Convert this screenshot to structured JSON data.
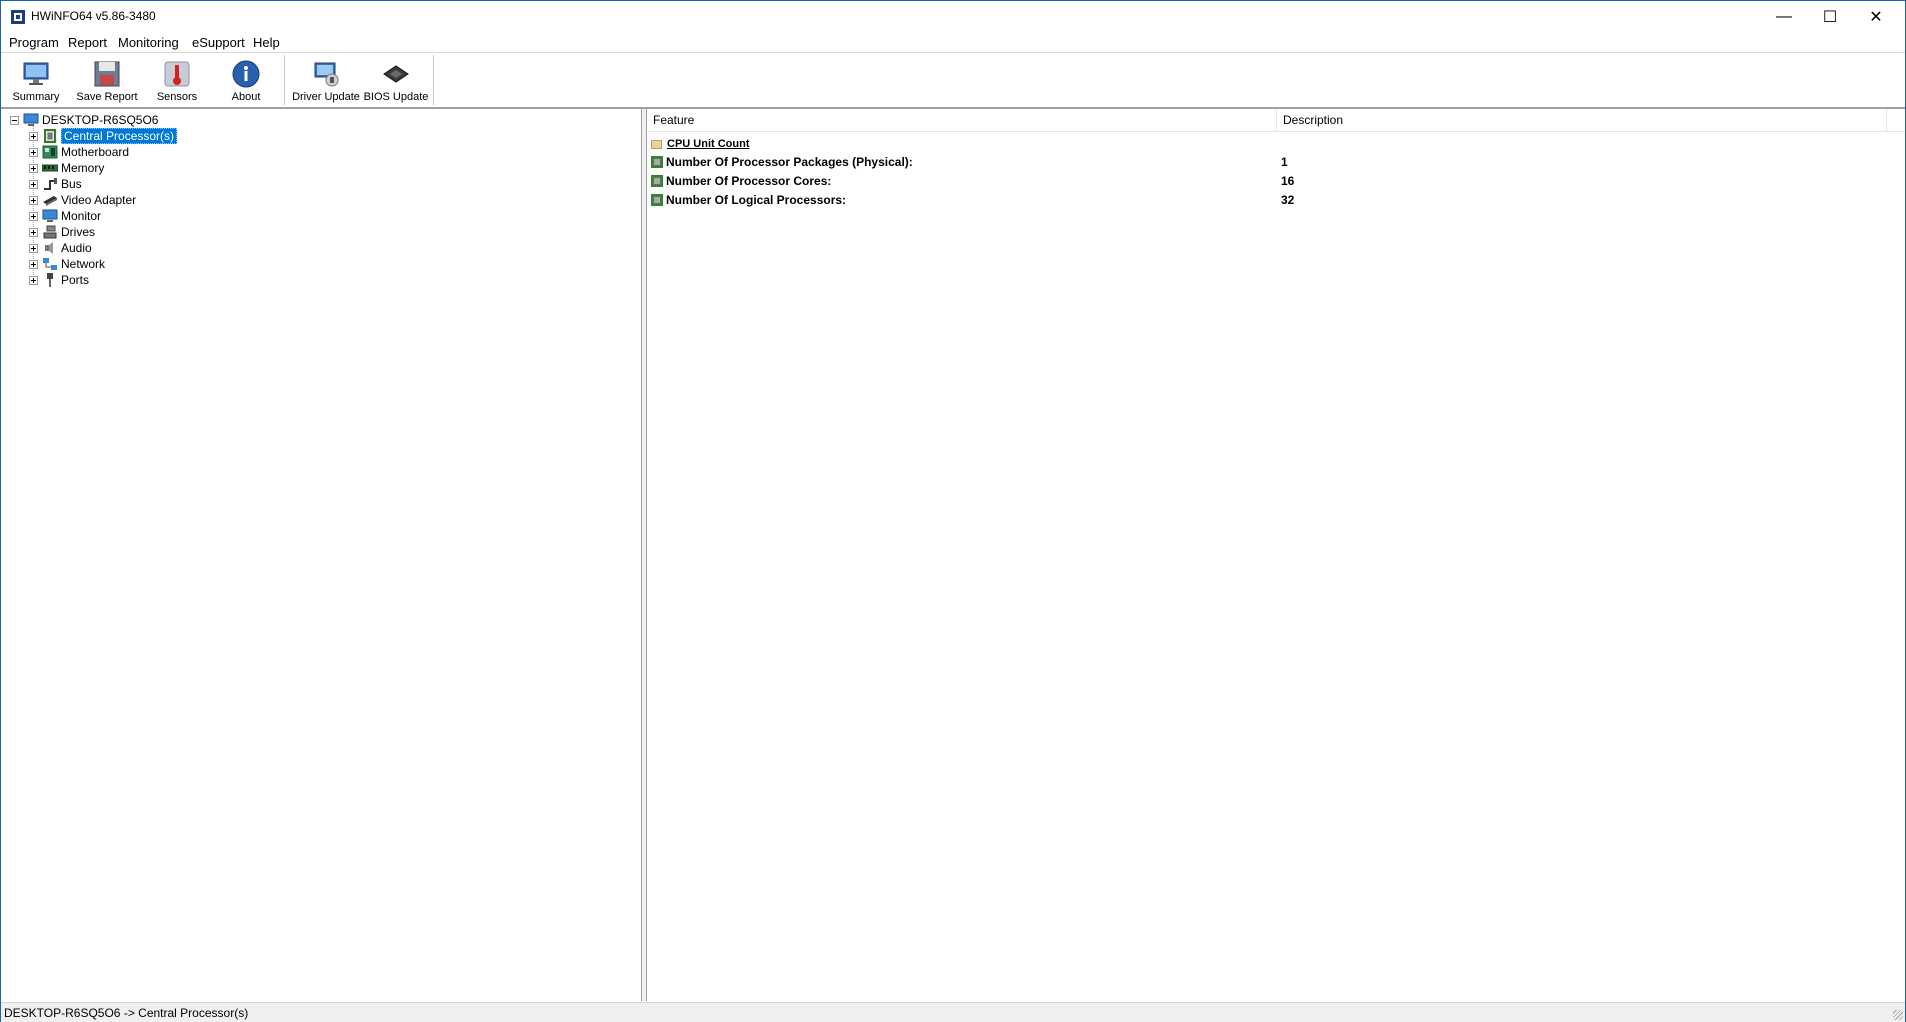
{
  "window": {
    "title": "HWiNFO64 v5.86-3480"
  },
  "window_controls": {
    "minimize": "—",
    "maximize": "☐",
    "close": "✕"
  },
  "menu": [
    "Program",
    "Report",
    "Monitoring",
    "eSupport",
    "Help"
  ],
  "toolbar": [
    {
      "label": "Summary",
      "icon": "monitor-icon"
    },
    {
      "label": "Save Report",
      "icon": "floppy-disk-icon"
    },
    {
      "label": "Sensors",
      "icon": "thermometer-icon"
    },
    {
      "label": "About",
      "icon": "info-icon"
    },
    {
      "label": "Driver Update",
      "icon": "driver-update-icon"
    },
    {
      "label": "BIOS Update",
      "icon": "bios-chip-icon"
    }
  ],
  "tree": {
    "root": "DESKTOP-R6SQ5O6",
    "items": [
      {
        "label": "Central Processor(s)",
        "icon": "cpu-icon",
        "selected": true
      },
      {
        "label": "Motherboard",
        "icon": "motherboard-icon"
      },
      {
        "label": "Memory",
        "icon": "memory-icon"
      },
      {
        "label": "Bus",
        "icon": "bus-icon"
      },
      {
        "label": "Video Adapter",
        "icon": "video-adapter-icon"
      },
      {
        "label": "Monitor",
        "icon": "monitor-icon"
      },
      {
        "label": "Drives",
        "icon": "drives-icon"
      },
      {
        "label": "Audio",
        "icon": "audio-icon"
      },
      {
        "label": "Network",
        "icon": "network-icon"
      },
      {
        "label": "Ports",
        "icon": "ports-icon"
      }
    ]
  },
  "list": {
    "columns": [
      "Feature",
      "Description"
    ],
    "category": "CPU Unit Count",
    "rows": [
      {
        "feature": "Number Of Processor Packages (Physical):",
        "description": "1"
      },
      {
        "feature": "Number Of Processor Cores:",
        "description": "16"
      },
      {
        "feature": "Number Of Logical Processors:",
        "description": "32"
      }
    ]
  },
  "status": {
    "text": "DESKTOP-R6SQ5O6 -> Central Processor(s)"
  },
  "colors": {
    "selection": "#0078d7",
    "window_border": "#1e5fae"
  }
}
